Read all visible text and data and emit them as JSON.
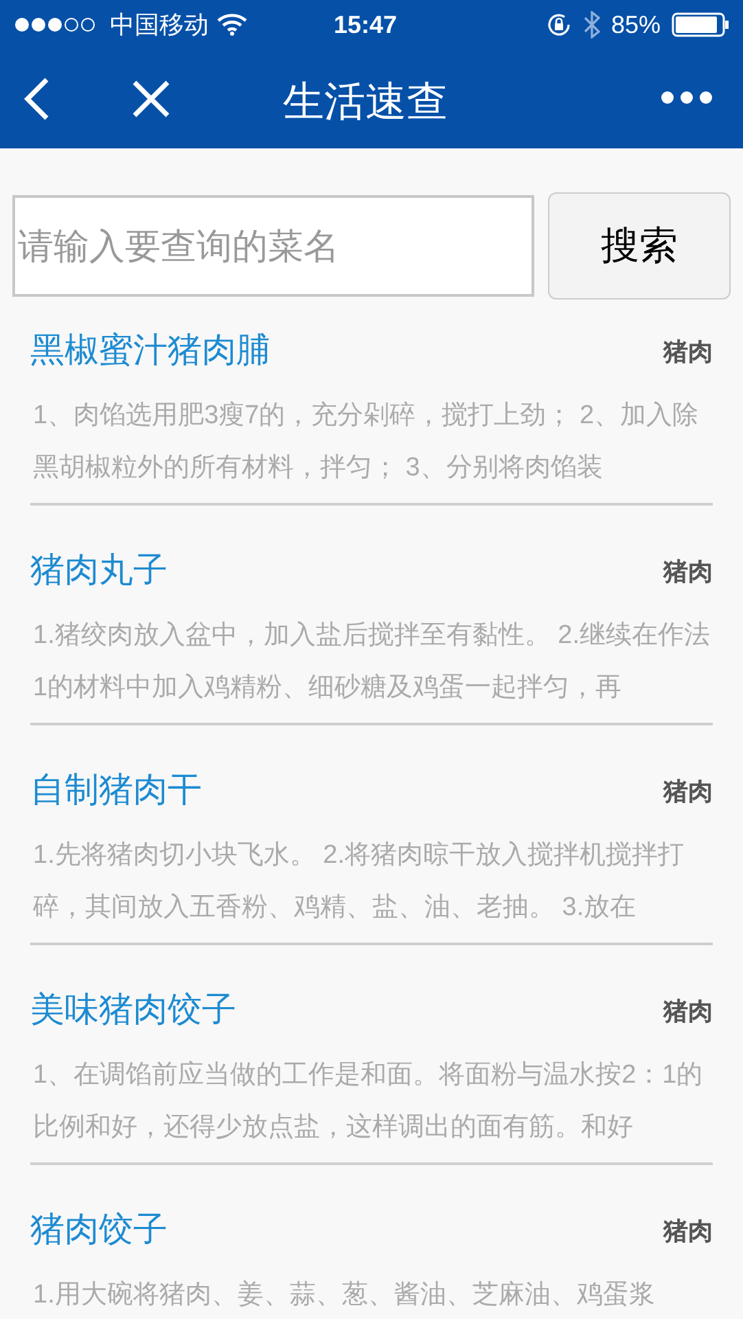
{
  "status_bar": {
    "carrier": "中国移动",
    "time": "15:47",
    "battery": "85%"
  },
  "nav": {
    "title": "生活速查"
  },
  "search": {
    "placeholder": "请输入要查询的菜名",
    "button": "搜索"
  },
  "results": [
    {
      "title": "黑椒蜜汁猪肉脯",
      "tag": "猪肉",
      "description": "1、肉馅选用肥3瘦7的，充分剁碎，搅打上劲； 2、加入除黑胡椒粒外的所有材料，拌匀； 3、分别将肉馅装"
    },
    {
      "title": "猪肉丸子",
      "tag": "猪肉",
      "description": "1.猪绞肉放入盆中，加入盐后搅拌至有黏性。 2.继续在作法1的材料中加入鸡精粉、细砂糖及鸡蛋一起拌匀，再"
    },
    {
      "title": "自制猪肉干",
      "tag": "猪肉",
      "description": "1.先将猪肉切小块飞水。 2.将猪肉晾干放入搅拌机搅拌打碎，其间放入五香粉、鸡精、盐、油、老抽。 3.放在"
    },
    {
      "title": "美味猪肉饺子",
      "tag": "猪肉",
      "description": "1、在调馅前应当做的工作是和面。将面粉与温水按2：1的比例和好，还得少放点盐，这样调出的面有筋。和好"
    },
    {
      "title": "猪肉饺子",
      "tag": "猪肉",
      "description": "1.用大碗将猪肉、姜、蒜、葱、酱油、芝麻油、鸡蛋浆"
    }
  ]
}
